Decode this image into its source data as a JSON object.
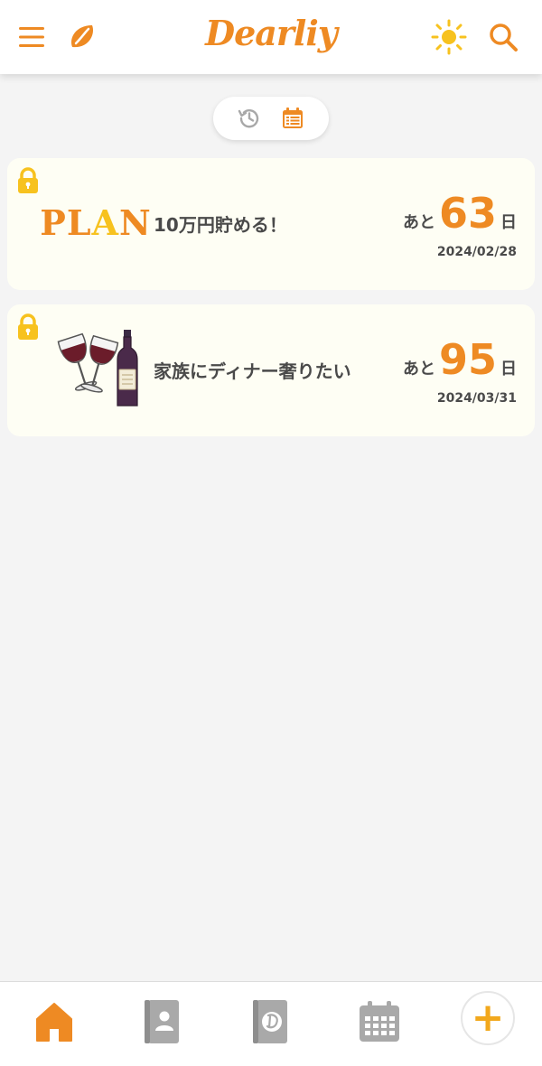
{
  "app": {
    "name": "Dearliy",
    "accent_color": "#ee8a23",
    "icons": [
      "menu-icon",
      "leaf-icon",
      "sun-icon",
      "search-icon"
    ]
  },
  "view_toggle": {
    "options": [
      "history-icon",
      "calendar-list-icon"
    ],
    "active": "calendar-list-icon"
  },
  "goals": [
    {
      "thumbnail": "PLAN",
      "title": "10万円貯める！",
      "prefix": "あと",
      "days": "63",
      "suffix": "日",
      "date": "2024/02/28",
      "locked": true
    },
    {
      "thumbnail": "wine-glasses-and-bottle",
      "title": "家族にディナー奢りたい",
      "prefix": "あと",
      "days": "95",
      "suffix": "日",
      "date": "2024/03/31",
      "locked": true
    }
  ],
  "bottom_nav": {
    "items": [
      "home-icon",
      "contacts-book-icon",
      "dearliy-diary-icon",
      "calendar-icon",
      "add-icon"
    ],
    "active": "home-icon",
    "add_label": "+"
  }
}
